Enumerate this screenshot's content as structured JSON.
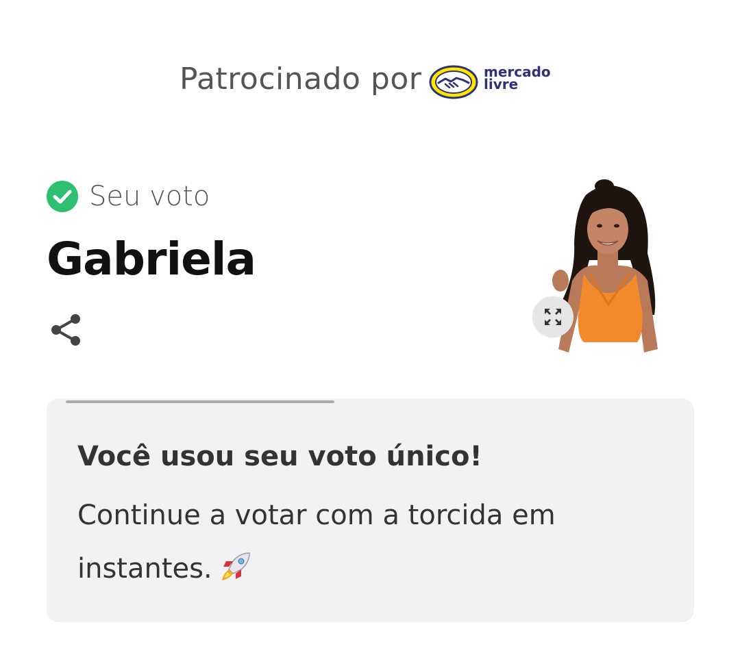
{
  "sponsor": {
    "label": "Patrocinado por",
    "logo_icon": "handshake-icon",
    "logo_line1": "mercado",
    "logo_line2": "livre",
    "logo_color": "#2d3277",
    "logo_bg": "#ffe600"
  },
  "vote": {
    "status_icon": "check-circle-icon",
    "status_color": "#2fbf71",
    "label": "Seu voto",
    "candidate_name": "Gabriela",
    "share_icon": "share-icon",
    "expand_icon": "expand-icon"
  },
  "notice": {
    "title": "Você usou seu voto único!",
    "body": "Continue a votar com a torcida em instantes.",
    "emoji_icon": "rocket-icon"
  }
}
